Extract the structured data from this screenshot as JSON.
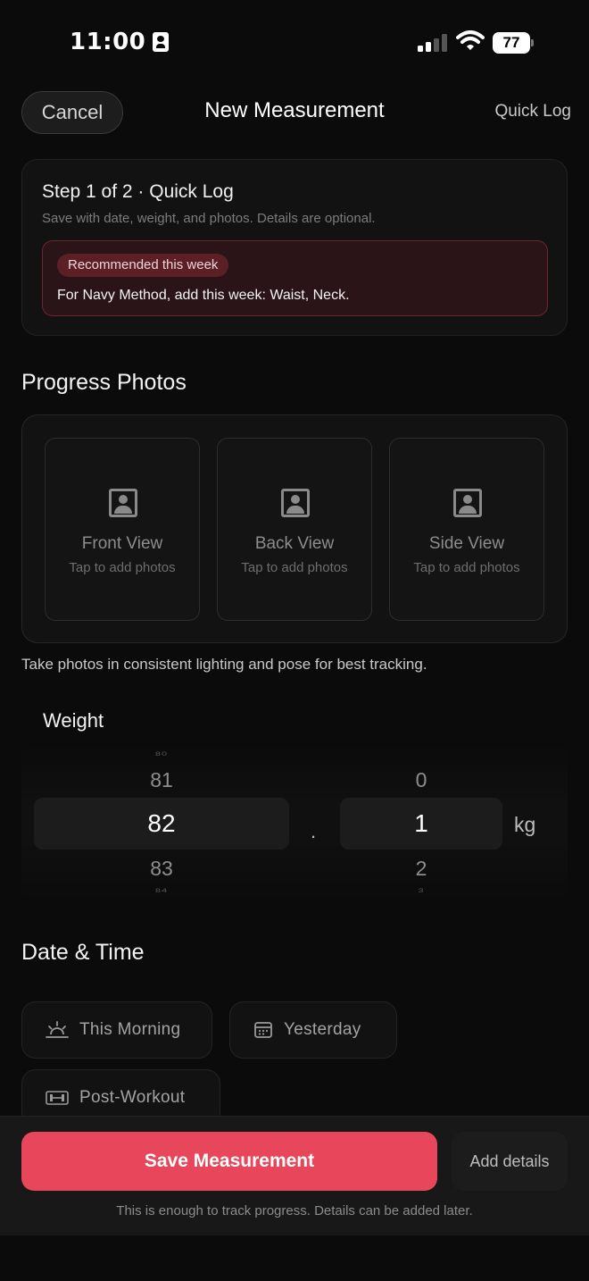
{
  "status_bar": {
    "time": "11:00",
    "battery": "77"
  },
  "nav": {
    "cancel_label": "Cancel",
    "title": "New Measurement",
    "quick_log_label": "Quick Log"
  },
  "step": {
    "title": "Step 1 of 2 · Quick Log",
    "subtitle": "Save with date, weight, and photos. Details are optional.",
    "recommendation_badge": "Recommended this week",
    "recommendation_text": "For Navy Method, add this week: Waist, Neck."
  },
  "photos": {
    "heading": "Progress Photos",
    "slots": [
      {
        "label": "Front View",
        "hint": "Tap to add photos"
      },
      {
        "label": "Back View",
        "hint": "Tap to add photos"
      },
      {
        "label": "Side View",
        "hint": "Tap to add photos"
      }
    ],
    "tip": "Take photos in consistent lighting and pose for best tracking."
  },
  "weight": {
    "label": "Weight",
    "integer_picker": {
      "far_above": "80",
      "above": "81",
      "selected": "82",
      "below": "83",
      "far_below": "84"
    },
    "separator": ".",
    "decimal_picker": {
      "above": "0",
      "selected": "1",
      "below": "2",
      "far_below": "3"
    },
    "unit": "kg"
  },
  "date_time": {
    "heading": "Date & Time",
    "presets": [
      {
        "label": "This Morning",
        "icon": "sunrise-icon"
      },
      {
        "label": "Yesterday",
        "icon": "calendar-icon"
      },
      {
        "label": "Post-Workout",
        "icon": "dumbbell-icon"
      }
    ]
  },
  "footer": {
    "save_label": "Save Measurement",
    "add_details_label": "Add details",
    "note": "This is enough to track progress. Details can be added later."
  },
  "colors": {
    "accent": "#e8465a",
    "background": "#0b0b0b",
    "card": "#121212",
    "recommendation_bg": "#2b1418"
  }
}
